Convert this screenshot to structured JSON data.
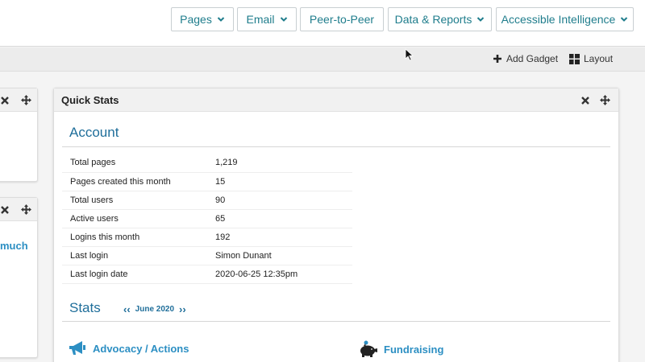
{
  "nav": {
    "items": [
      {
        "label": "Pages",
        "dropdown": true
      },
      {
        "label": "Email",
        "dropdown": true
      },
      {
        "label": "Peer-to-Peer",
        "dropdown": false
      },
      {
        "label": "Data & Reports",
        "dropdown": true
      },
      {
        "label": "Accessible Intelligence",
        "dropdown": true
      }
    ]
  },
  "toolbar": {
    "add_gadget": "Add Gadget",
    "layout": "Layout"
  },
  "left_gadget": {
    "partial_link": "much"
  },
  "quick_stats": {
    "title": "Quick Stats",
    "account_heading": "Account",
    "rows": [
      {
        "label": "Total pages",
        "value": "1,219"
      },
      {
        "label": "Pages created this month",
        "value": "15"
      },
      {
        "label": "Total users",
        "value": "90"
      },
      {
        "label": "Active users",
        "value": "65"
      },
      {
        "label": "Logins this month",
        "value": "192"
      },
      {
        "label": "Last login",
        "value": "Simon Dunant"
      },
      {
        "label": "Last login date",
        "value": "2020-06-25 12:35pm"
      }
    ],
    "stats_heading": "Stats",
    "month": "June 2020",
    "prev_arrow": "‹‹",
    "next_arrow": "››",
    "categories": [
      "Advocacy / Actions",
      "Fundraising"
    ]
  },
  "colors": {
    "accent": "#1f7d8c",
    "heading": "#1f6e9a",
    "link": "#2c8fc3"
  }
}
